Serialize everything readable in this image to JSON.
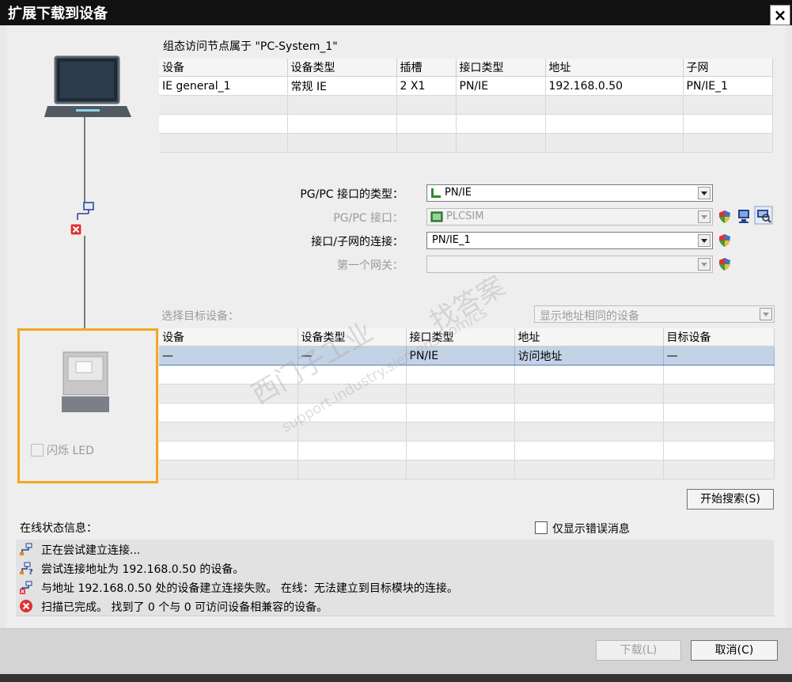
{
  "window": {
    "title": "扩展下载到设备",
    "close_label": "×"
  },
  "config": {
    "caption": "组态访问节点属于 \"PC-System_1\"",
    "columns": [
      "设备",
      "设备类型",
      "插槽",
      "接口类型",
      "地址",
      "子网"
    ],
    "rows": [
      [
        "IE general_1",
        "常规 IE",
        "2 X1",
        "PN/IE",
        "192.168.0.50",
        "PN/IE_1"
      ]
    ]
  },
  "interface": {
    "type_label": "PG/PC 接口的类型：",
    "type_value": "PN/IE",
    "iface_label": "PG/PC 接口：",
    "iface_value": "PLCSIM",
    "subnet_label": "接口/子网的连接：",
    "subnet_value": "PN/IE_1",
    "gateway_label": "第一个网关：",
    "gateway_value": ""
  },
  "target": {
    "label": "选择目标设备：",
    "filter_value": "显示地址相同的设备",
    "columns": [
      "设备",
      "设备类型",
      "接口类型",
      "地址",
      "目标设备"
    ],
    "rows": [
      [
        "—",
        "—",
        "PN/IE",
        "访问地址",
        "—"
      ]
    ],
    "flash_led_label": "闪烁 LED",
    "search_button": "开始搜索(S)"
  },
  "status": {
    "title": "在线状态信息：",
    "errors_only_label": "仅显示错误消息",
    "messages": [
      {
        "icon": "connecting-icon",
        "text": "正在尝试建立连接..."
      },
      {
        "icon": "connection-query-icon",
        "text": "尝试连接地址为 192.168.0.50 的设备。"
      },
      {
        "icon": "connection-failed-icon",
        "text": "与地址 192.168.0.50 处的设备建立连接失败。 在线：无法建立到目标模块的连接。"
      },
      {
        "icon": "error-icon",
        "text": "扫描已完成。 找到了 0 个与 0 可访问设备相兼容的设备。"
      }
    ]
  },
  "buttons": {
    "download": "下载(L)",
    "cancel": "取消(C)"
  },
  "watermark": {
    "line1": "西门子工业",
    "line2": "找答案",
    "line3": "support.industry.siemens.com/cs"
  },
  "colors": {
    "highlight_border": "#f5a623",
    "selected_row": "#c4d2e6",
    "title_bar": "#111111"
  }
}
